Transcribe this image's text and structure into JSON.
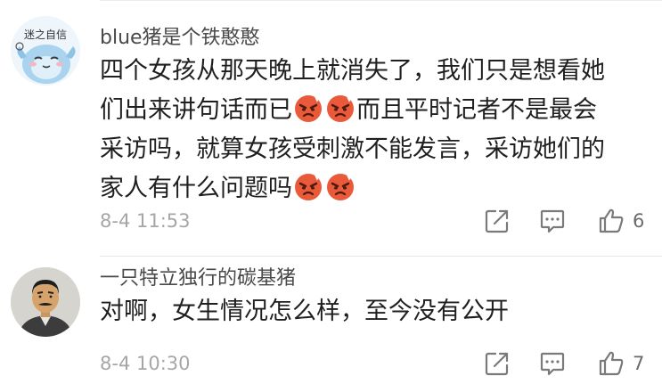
{
  "comments": [
    {
      "username": "blue猪是个铁憨憨",
      "lines": [
        [
          "四个女孩从那天晚上就消失了，我们只是想看她"
        ],
        [
          "们出来讲句话而已",
          "[emoji]",
          "[emoji]",
          "而且平时记者不是最会"
        ],
        [
          "采访吗，就算女孩受刺激不能发言，采访她们的"
        ],
        [
          "家人有什么问题吗",
          "[emoji]",
          "[emoji]"
        ]
      ],
      "time": "8-4 11:53",
      "likes": "6"
    },
    {
      "username": "一只特立独行的碳基猪",
      "lines": [
        [
          "对啊，女生情况怎么样，至今没有公开"
        ]
      ],
      "time": "8-4 10:30",
      "likes": "7"
    }
  ],
  "icons": {
    "share": "share-icon",
    "reply": "reply-icon",
    "like": "thumbs-up-icon",
    "emoji": "angry-face-emoji-icon"
  },
  "avatar1_text": "迷之自信"
}
